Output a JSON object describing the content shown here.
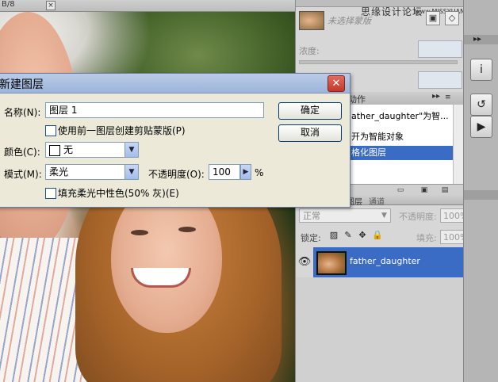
{
  "document": {
    "title_fragment": "B/8",
    "close_glyph": "×"
  },
  "masks_panel": {
    "watermark": "思缘设计论坛",
    "watermark_url": "www.MISSYUAN.com",
    "no_selection_label": "未选择蒙版",
    "density_label": "浓度:"
  },
  "actions_panel": {
    "tab_label": "动作",
    "menu_glyph": "▸▸",
    "items": [
      "ather_daughter\"为智...",
      "开为智能对象",
      "格化图层"
    ],
    "footer_icons": [
      "▭",
      "▣",
      "▤"
    ]
  },
  "layers_panel": {
    "tab_layers": "图层",
    "tab_channels": "通道",
    "blend_mode": "正常",
    "opacity_label": "不透明度:",
    "opacity_value": "100%",
    "lock_label": "锁定:",
    "fill_label": "填充:",
    "fill_value": "100%",
    "layers": [
      {
        "name": "father_daughter",
        "selected": true
      }
    ]
  },
  "dock": {
    "close_glyph": "▸▸",
    "buttons": [
      "i",
      "↺",
      "▶"
    ]
  },
  "dialog": {
    "title": "新建图层",
    "close_glyph": "✕",
    "name_label": "名称(N):",
    "name_value": "图层 1",
    "clip_checkbox_label": "使用前一图层创建剪贴蒙版(P)",
    "clip_checked": false,
    "color_label": "颜色(C):",
    "color_value": "无",
    "mode_label": "模式(M):",
    "mode_value": "柔光",
    "opacity_label": "不透明度(O):",
    "opacity_value": "100",
    "opacity_unit": "%",
    "fill_checkbox_label": "填充柔光中性色(50% 灰)(E)",
    "fill_checked": false,
    "ok_label": "确定",
    "cancel_label": "取消"
  },
  "icons": {
    "dropdown": "▼",
    "spin": "▶",
    "eye": "👁",
    "lock_pixels": "▨",
    "lock_paint": "✎",
    "lock_move": "✥",
    "lock_all": "🔒"
  }
}
